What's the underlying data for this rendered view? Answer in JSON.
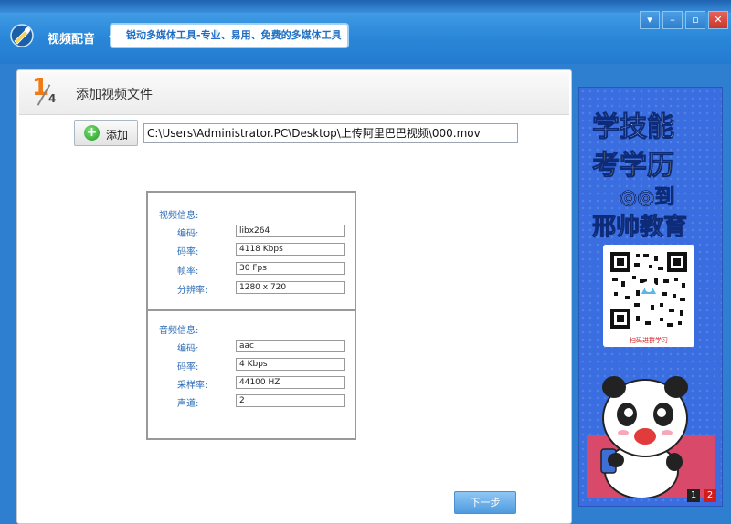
{
  "app": {
    "title": "视频配音",
    "slogan": "锐动多媒体工具-专业、易用、免费的多媒体工具",
    "window_controls": [
      "▾",
      "–",
      "▫",
      "✕"
    ]
  },
  "step": {
    "current": "1",
    "total": "4",
    "title": "添加视频文件"
  },
  "toolbar": {
    "add_label": "添加",
    "path_value": "C:\\Users\\Administrator.PC\\Desktop\\上传阿里巴巴视频\\000.mov"
  },
  "video_info": {
    "title": "视频信息:",
    "rows": [
      {
        "label": "编码:",
        "value": "libx264"
      },
      {
        "label": "码率:",
        "value": "4118 Kbps"
      },
      {
        "label": "帧率:",
        "value": "30 Fps"
      },
      {
        "label": "分辨率:",
        "value": "1280 x 720"
      }
    ]
  },
  "audio_info": {
    "title": "音频信息:",
    "rows": [
      {
        "label": "编码:",
        "value": "aac"
      },
      {
        "label": "码率:",
        "value": "4 Kbps"
      },
      {
        "label": "采样率:",
        "value": "44100 HZ"
      },
      {
        "label": "声道:",
        "value": "2"
      }
    ]
  },
  "footer": {
    "next_label": "下一步"
  },
  "ad": {
    "line1": "学技能",
    "line2": "考学历",
    "line3": "◎◎到",
    "line4": "邢帅教育",
    "caption": "扫码进群学习",
    "pages": [
      "1",
      "2"
    ],
    "active_page": "2"
  },
  "colors": {
    "titlebar": "#2a86d8",
    "step_accent": "#ef7a16",
    "label_blue": "#2b6bb5",
    "next_button": "#4f9be0",
    "ad_background": "#3a6ee0"
  }
}
